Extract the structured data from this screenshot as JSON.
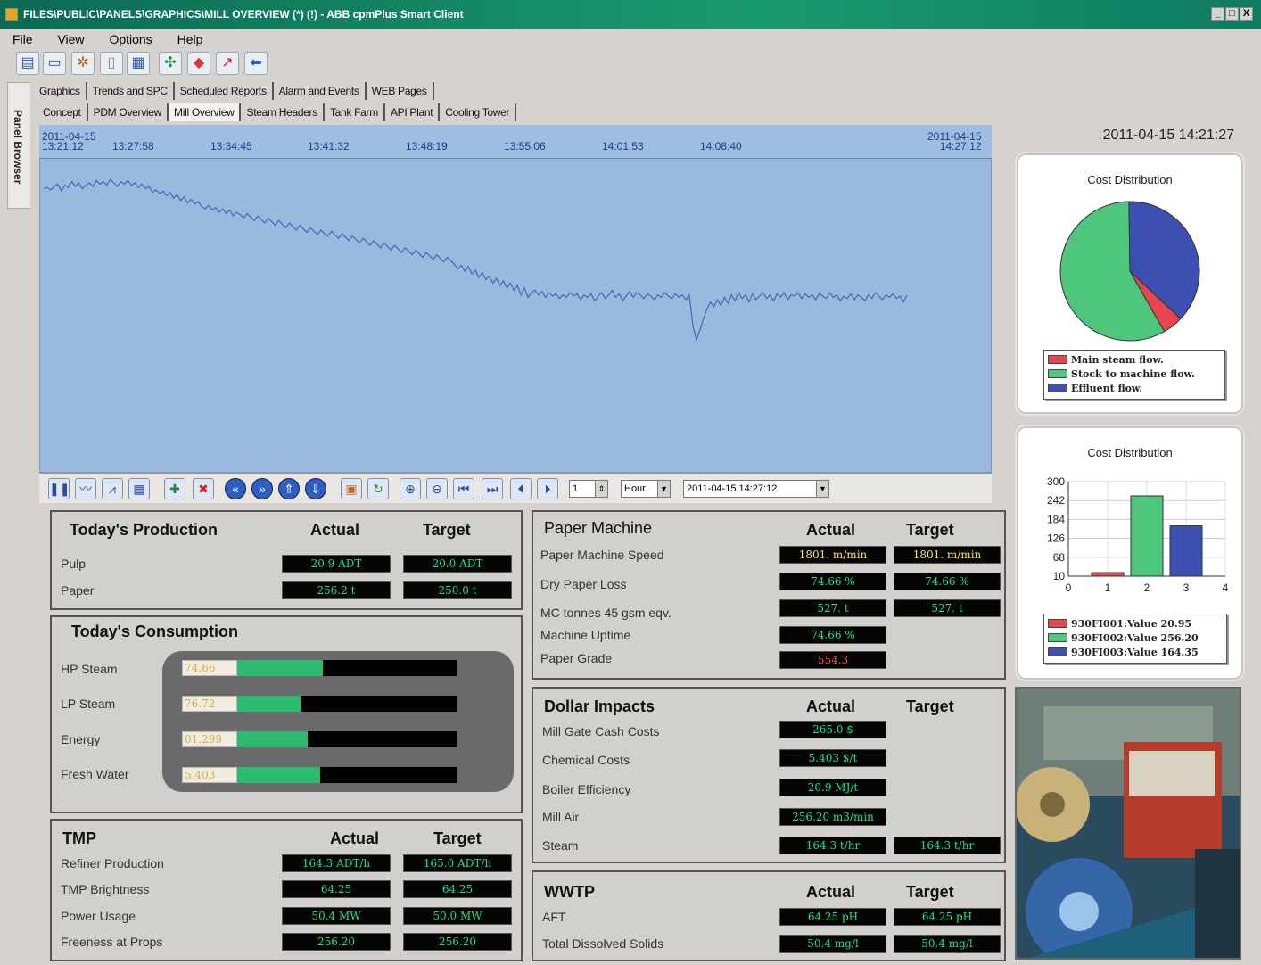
{
  "window": {
    "title": "FILES\\PUBLIC\\PANELS\\GRAPHICS\\MILL OVERVIEW (*) (!) - ABB cpmPlus Smart Client",
    "min": "_",
    "max": "□",
    "close": "X"
  },
  "menu": [
    "File",
    "View",
    "Options",
    "Help"
  ],
  "side_tab": "Panel Browser",
  "tabs_top": [
    "Graphics",
    "Trends and SPC",
    "Scheduled Reports",
    "Alarm and Events",
    "WEB Pages"
  ],
  "tabs_second": [
    "Concept",
    "PDM Overview",
    "Mill Overview",
    "Steam Headers",
    "Tank Farm",
    "API Plant",
    "Cooling Tower"
  ],
  "active_tab": "Mill Overview",
  "trend": {
    "start_date": "2011-04-15",
    "start_time": "13:21:12",
    "end_date": "2011-04-15",
    "end_time": "14:27:12",
    "ticks": [
      "13:27:58",
      "13:34:45",
      "13:41:32",
      "13:48:19",
      "13:55:06",
      "14:01:53",
      "14:08:40"
    ],
    "series": [
      20,
      21,
      19,
      22,
      24,
      18,
      23,
      21,
      26,
      22,
      25,
      20,
      23,
      25,
      22,
      27,
      24,
      26,
      23,
      28,
      25,
      22,
      26,
      24,
      27,
      23,
      25,
      21,
      24,
      20,
      22,
      17,
      19,
      16,
      18,
      14,
      17,
      12,
      15,
      10,
      13,
      8,
      11,
      7,
      9,
      5,
      3,
      6,
      2,
      4,
      0,
      3,
      -1,
      2,
      -3,
      0,
      -2,
      -5,
      -1,
      -4,
      -7,
      -3,
      -6,
      -9,
      -5,
      -8,
      -11,
      -7,
      -10,
      -13,
      -9,
      -12,
      -15,
      -11,
      -14,
      -17,
      -13,
      -16,
      -19,
      -15,
      -18,
      -20,
      -16,
      -19,
      -22,
      -18,
      -21,
      -24,
      -20,
      -23,
      -26,
      -22,
      -25,
      -28,
      -24,
      -27,
      -30,
      -26,
      -29,
      -32,
      -28,
      -31,
      -34,
      -30,
      -33,
      -36,
      -32,
      -35,
      -38,
      -34,
      -37,
      -40,
      -36,
      -39,
      -42,
      -38,
      -41,
      -44,
      -48,
      -45,
      -50,
      -46,
      -52,
      -49,
      -55,
      -51,
      -57,
      -54,
      -60,
      -56,
      -62,
      -58,
      -64,
      -60,
      -66,
      -62,
      -70,
      -64,
      -72,
      -68,
      -66,
      -70,
      -67,
      -72,
      -68,
      -71,
      -69,
      -73,
      -70,
      -72,
      -68,
      -71,
      -69,
      -74,
      -70,
      -72,
      -69,
      -75,
      -71,
      -68,
      -73,
      -70,
      -66,
      -72,
      -69,
      -75,
      -71,
      -67,
      -72,
      -68,
      -70,
      -73,
      -69,
      -71,
      -74,
      -70,
      -72,
      -68,
      -71,
      -73,
      -69,
      -72,
      -70,
      -74,
      -70,
      -96,
      -108,
      -100,
      -90,
      -82,
      -76,
      -80,
      -74,
      -79,
      -72,
      -77,
      -70,
      -75,
      -68,
      -73,
      -70,
      -76,
      -69,
      -74,
      -71,
      -68,
      -73,
      -70,
      -75,
      -69,
      -72,
      -68,
      -74,
      -70,
      -71,
      -68,
      -73,
      -69,
      -72,
      -70,
      -74,
      -69,
      -71,
      -73,
      -68,
      -72,
      -70,
      -75,
      -71,
      -73,
      -69,
      -74,
      -70,
      -72,
      -75,
      -70,
      -73,
      -68,
      -71,
      -74,
      -70,
      -72,
      -69,
      -73,
      -71,
      -76,
      -70
    ]
  },
  "trend_controls": {
    "spin_value": "1",
    "unit": "Hour",
    "datetime": "2011-04-15 14:27:12"
  },
  "timestamp": "2011-04-15 14:21:27",
  "pie": {
    "title": "Cost Distribution",
    "legend": [
      "Main steam flow.",
      "Stock to machine flow.",
      "Effluent flow."
    ],
    "colors": [
      "#e8454f",
      "#4fc67d",
      "#3d4fb0"
    ]
  },
  "chart_data": [
    {
      "type": "pie",
      "title": "Cost Distribution",
      "labels": [
        "Main steam flow.",
        "Stock to machine flow.",
        "Effluent flow."
      ],
      "values": [
        20.95,
        256.2,
        164.35
      ]
    },
    {
      "type": "bar",
      "title": "Cost Distribution",
      "x": [
        1,
        2,
        3
      ],
      "values": [
        20.95,
        256.2,
        164.35
      ],
      "xlim": [
        0,
        4
      ],
      "ylim": [
        10,
        300
      ],
      "yticks": [
        10,
        68,
        126,
        184,
        242,
        300
      ],
      "xticks": [
        0,
        1,
        2,
        3,
        4
      ],
      "legend": [
        "930FI001:Value 20.95",
        "930FI002:Value 256.20",
        "930FI003:Value 164.35"
      ],
      "colors": [
        "#e8454f",
        "#4fc67d",
        "#3d4fb0"
      ]
    }
  ],
  "production": {
    "title": "Today's Production",
    "actual": "Actual",
    "target": "Target",
    "rows": [
      {
        "label": "Pulp",
        "actual": "20.9  ADT",
        "target": "20.0  ADT"
      },
      {
        "label": "Paper",
        "actual": "256.2  t",
        "target": "250.0  t"
      }
    ]
  },
  "consumption": {
    "title": "Today's Consumption",
    "rows": [
      {
        "label": "HP Steam",
        "value": "74.66",
        "fill": 0.39
      },
      {
        "label": "LP Steam",
        "value": "76.72",
        "fill": 0.29
      },
      {
        "label": "Energy",
        "value": "01.299",
        "fill": 0.32
      },
      {
        "label": "Fresh Water",
        "value": "5.403",
        "fill": 0.38
      }
    ]
  },
  "tmp": {
    "title": "TMP",
    "actual": "Actual",
    "target": "Target",
    "rows": [
      {
        "label": "Refiner Production",
        "actual": "164.3  ADT/h",
        "target": "165.0  ADT/h"
      },
      {
        "label": "TMP Brightness",
        "actual": "64.25",
        "target": "64.25"
      },
      {
        "label": "Power Usage",
        "actual": "50.4  MW",
        "target": "50.0  MW"
      },
      {
        "label": "Freeness at Props",
        "actual": "256.20",
        "target": "256.20"
      }
    ]
  },
  "paper_machine": {
    "title": "Paper Machine",
    "actual": "Actual",
    "target": "Target",
    "rows": [
      {
        "label": "Paper Machine Speed",
        "actual": "1801.  m/min",
        "target": "1801.  m/min"
      },
      {
        "label": "Dry Paper Loss",
        "actual": "74.66  %",
        "target": "74.66  %"
      },
      {
        "label": "MC tonnes 45 gsm eqv.",
        "actual": "527.  t",
        "target": "527.  t"
      },
      {
        "label": "Machine Uptime",
        "actual": "74.66  %",
        "target": ""
      },
      {
        "label": "Paper Grade",
        "actual": "554.3",
        "target": ""
      }
    ]
  },
  "dollar": {
    "title": "Dollar Impacts",
    "actual": "Actual",
    "target": "Target",
    "rows": [
      {
        "label": "Mill Gate Cash Costs",
        "actual": "265.0  $",
        "target": ""
      },
      {
        "label": "Chemical Costs",
        "actual": "5.403  $/t",
        "target": ""
      },
      {
        "label": "Boiler Efficiency",
        "actual": "20.9  MJ/t",
        "target": ""
      },
      {
        "label": "Mill Air",
        "actual": "256.20  m3/min",
        "target": ""
      },
      {
        "label": "Steam",
        "actual": "164.3  t/hr",
        "target": "164.3  t/hr"
      }
    ]
  },
  "wwtp": {
    "title": "WWTP",
    "actual": "Actual",
    "target": "Target",
    "rows": [
      {
        "label": "AFT",
        "actual": "64.25  pH",
        "target": "64.25  pH"
      },
      {
        "label": "Total Dissolved Solids",
        "actual": "50.4  mg/l",
        "target": "50.4  mg/l"
      }
    ]
  }
}
